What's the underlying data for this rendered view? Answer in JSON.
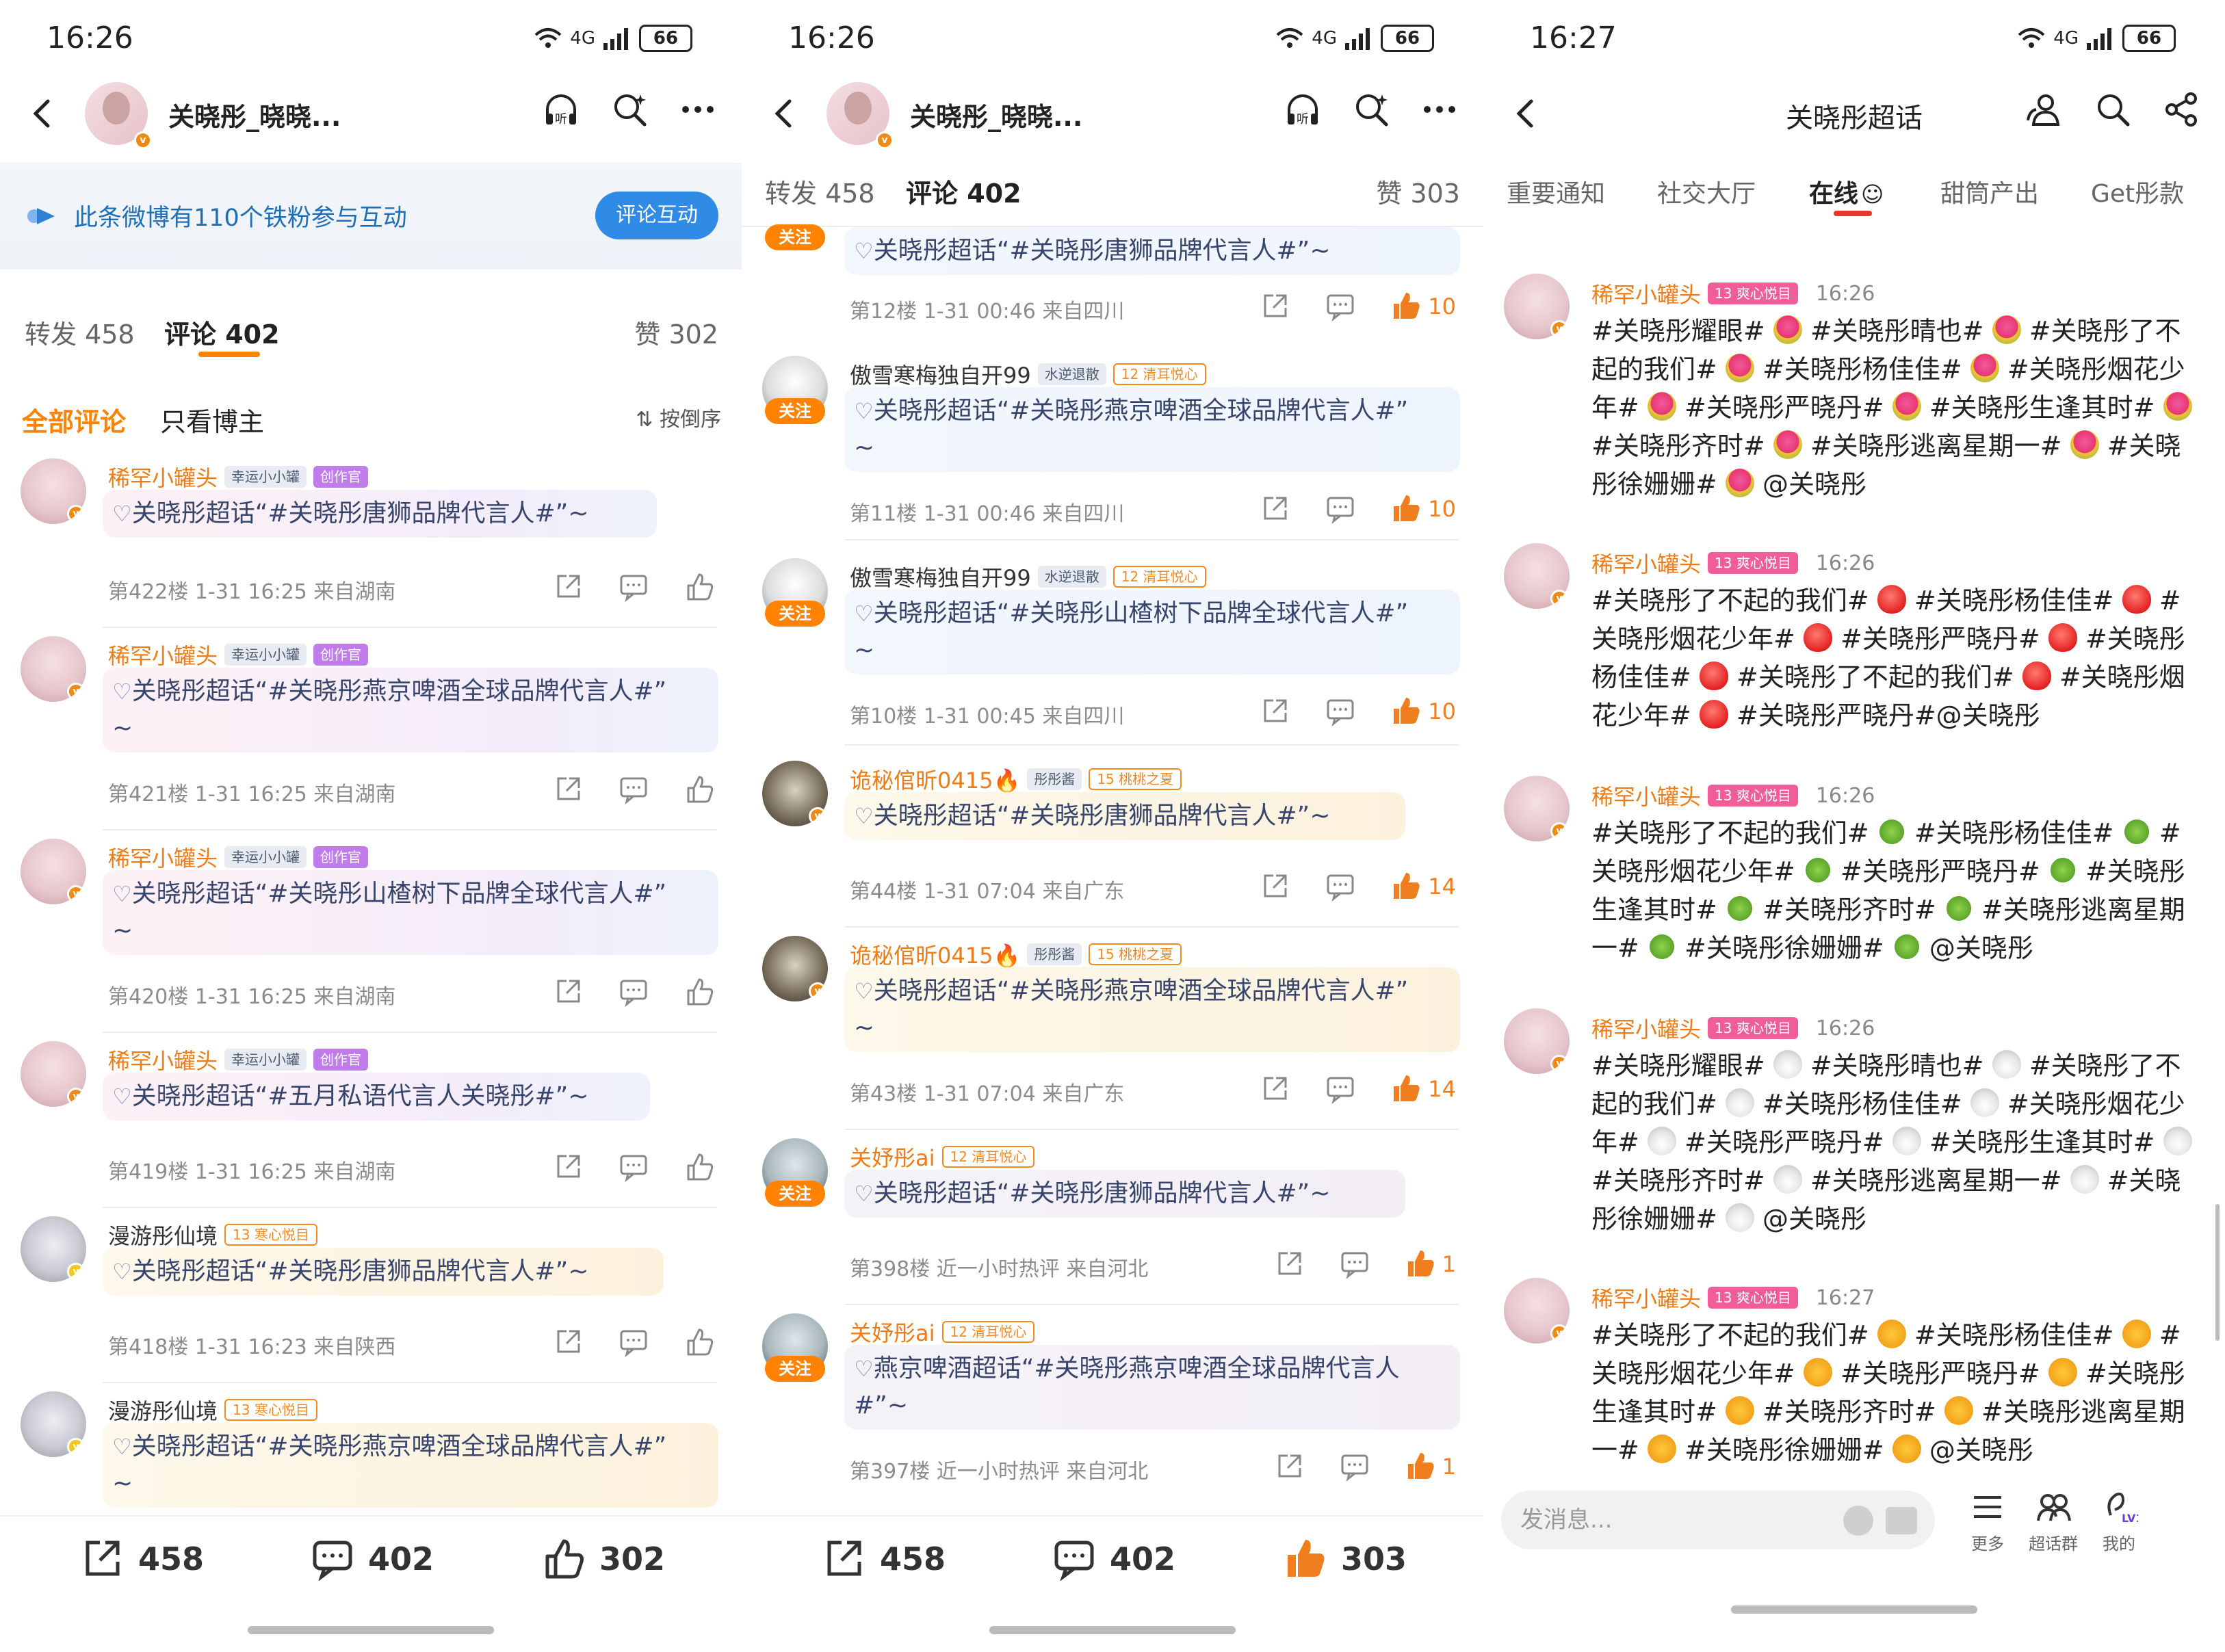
{
  "p1": {
    "status": {
      "time": "16:26",
      "net": "4G",
      "battery": "66"
    },
    "nav": {
      "title": "关晓彤_晓晓..."
    },
    "banner": {
      "text": "此条微博有110个铁粉参与互动",
      "button": "评论互动"
    },
    "tabs": {
      "repost": "转发 458",
      "comment": "评论 402",
      "like": "赞 302"
    },
    "filters": {
      "all": "全部评论",
      "owner": "只看博主",
      "sort": "按倒序"
    },
    "comments": [
      {
        "name": "稀罕小罐头",
        "badge1": "幸运小小罐",
        "badge2": "创作官",
        "text": "关晓彤超话“#关晓彤唐狮品牌代言人#”~",
        "meta": "第422楼 1-31 16:25 来自湖南"
      },
      {
        "name": "稀罕小罐头",
        "badge1": "幸运小小罐",
        "badge2": "创作官",
        "text": "关晓彤超话“#关晓彤燕京啤酒全球品牌代言人#”",
        "text2": "~",
        "meta": "第421楼 1-31 16:25 来自湖南"
      },
      {
        "name": "稀罕小罐头",
        "badge1": "幸运小小罐",
        "badge2": "创作官",
        "text": "关晓彤超话“#关晓彤山楂树下品牌全球代言人#”",
        "text2": "~",
        "meta": "第420楼 1-31 16:25 来自湖南"
      },
      {
        "name": "稀罕小罐头",
        "badge1": "幸运小小罐",
        "badge2": "创作官",
        "text": "关晓彤超话“#五月私语代言人关晓彤#”~",
        "meta": "第419楼 1-31 16:25 来自湖南"
      },
      {
        "name": "漫游彤仙境",
        "badge1": "13 寒心悦目",
        "text": "关晓彤超话“#关晓彤唐狮品牌代言人#”~",
        "meta": "第418楼 1-31 16:23 来自陕西"
      },
      {
        "name": "漫游彤仙境",
        "badge1": "13 寒心悦目",
        "text": "关晓彤超话“#关晓彤燕京啤酒全球品牌代言人#”",
        "text2": "~"
      }
    ],
    "bottom": {
      "repost": "458",
      "comment": "402",
      "like": "302"
    }
  },
  "p2": {
    "status": {
      "time": "16:26",
      "net": "4G",
      "battery": "66"
    },
    "nav": {
      "title": "关晓彤_晓晓..."
    },
    "tabs": {
      "repost": "转发 458",
      "comment": "评论 402",
      "like": "赞 303"
    },
    "follow_label": "关注",
    "partial": {
      "text": "关晓彤超话“#关晓彤唐狮品牌代言人#”~",
      "meta": "第12楼 1-31 00:46 来自四川",
      "likes": "10"
    },
    "comments": [
      {
        "name": "傲雪寒梅独自开99",
        "badge1": "水逆退散",
        "badge2": "12 清耳悦心",
        "text": "关晓彤超话“#关晓彤燕京啤酒全球品牌代言人#”",
        "text2": "~",
        "meta": "第11楼 1-31 00:46 来自四川",
        "likes": "10"
      },
      {
        "name": "傲雪寒梅独自开99",
        "badge1": "水逆退散",
        "badge2": "12 清耳悦心",
        "text": "关晓彤超话“#关晓彤山楂树下品牌全球代言人#”",
        "text2": "~",
        "meta": "第10楼 1-31 00:45 来自四川",
        "likes": "10"
      },
      {
        "name": "诡秘倌昕0415🔥",
        "badge1": "彤彤酱",
        "badge2": "15 桃桃之夏",
        "text": "关晓彤超话“#关晓彤唐狮品牌代言人#”~",
        "meta": "第44楼 1-31 07:04 来自广东",
        "likes": "14"
      },
      {
        "name": "诡秘倌昕0415🔥",
        "badge1": "彤彤酱",
        "badge2": "15 桃桃之夏",
        "text": "关晓彤超话“#关晓彤燕京啤酒全球品牌代言人#”",
        "text2": "~",
        "meta": "第43楼 1-31 07:04 来自广东",
        "likes": "14"
      },
      {
        "name": "关妤彤ai",
        "badge1": "12 清耳悦心",
        "text": "关晓彤超话“#关晓彤唐狮品牌代言人#”~",
        "meta": "第398楼 近一小时热评 来自河北",
        "likes": "1"
      },
      {
        "name": "关妤彤ai",
        "badge1": "12 清耳悦心",
        "text": "燕京啤酒超话“#关晓彤燕京啤酒全球品牌代言人",
        "text2": "#”~",
        "meta": "第397楼 近一小时热评 来自河北",
        "likes": "1"
      }
    ],
    "bottom": {
      "repost": "458",
      "comment": "402",
      "like": "303"
    }
  },
  "p3": {
    "status": {
      "time": "16:27",
      "net": "4G",
      "battery": "66"
    },
    "nav": {
      "title": "关晓彤超话"
    },
    "tabs": [
      "重要通知",
      "社交大厅",
      "在线",
      "甜筒产出",
      "Get彤款"
    ],
    "posts": [
      {
        "name": "稀罕小罐头",
        "badge": "13 爽心悦目",
        "time": "16:26",
        "icon": "flower",
        "lines": [
          "#关晓彤耀眼# ",
          " #关晓彤晴也# ",
          " #关晓彤了不起的我们# ",
          " #关晓彤杨佳佳# ",
          " #关晓彤烟花少年# ",
          " #关晓彤严晓丹# ",
          " #关晓彤生逢其时# ",
          " #关晓彤齐时# ",
          " #关晓彤逃离星期一# ",
          " #关晓彤徐姗姗# ",
          " @关晓彤"
        ]
      },
      {
        "name": "稀罕小罐头",
        "badge": "13 爽心悦目",
        "time": "16:26",
        "icon": "balloon",
        "lines": [
          "#关晓彤了不起的我们# ",
          " #关晓彤杨佳佳# ",
          " #关晓彤烟花少年# ",
          " #关晓彤严晓丹# ",
          " #关晓彤杨佳佳# ",
          " #关晓彤了不起的我们# ",
          " #关晓彤烟花少年# ",
          " #关晓彤严晓丹#@关晓彤"
        ]
      },
      {
        "name": "稀罕小罐头",
        "badge": "13 爽心悦目",
        "time": "16:26",
        "icon": "sprout",
        "lines": [
          "#关晓彤了不起的我们# ",
          " #关晓彤杨佳佳# ",
          " #关晓彤烟花少年# ",
          " #关晓彤严晓丹# ",
          " #关晓彤生逢其时# ",
          " #关晓彤齐时# ",
          " #关晓彤逃离星期一# ",
          " #关晓彤徐姗姗# ",
          " @关晓彤"
        ]
      },
      {
        "name": "稀罕小罐头",
        "badge": "13 爽心悦目",
        "time": "16:26",
        "icon": "bunny",
        "lines": [
          "#关晓彤耀眼# ",
          " #关晓彤晴也# ",
          " #关晓彤了不起的我们# ",
          " #关晓彤杨佳佳# ",
          " #关晓彤烟花少年# ",
          " #关晓彤严晓丹# ",
          " #关晓彤生逢其时# ",
          " #关晓彤齐时# ",
          " #关晓彤逃离星期一# ",
          " #关晓彤徐姗姗# ",
          " @关晓彤"
        ]
      },
      {
        "name": "稀罕小罐头",
        "badge": "13 爽心悦目",
        "time": "16:27",
        "icon": "smile",
        "lines": [
          "#关晓彤了不起的我们# ",
          " #关晓彤杨佳佳# ",
          " #关晓彤烟花少年# ",
          " #关晓彤严晓丹# ",
          " #关晓彤生逢其时# ",
          " #关晓彤齐时# ",
          " #关晓彤逃离星期一# ",
          " #关晓彤徐姗姗# ",
          " @关晓彤"
        ]
      }
    ],
    "chat": {
      "placeholder": "发消息...",
      "more": "更多",
      "group": "超话群",
      "mine": "我的"
    }
  }
}
